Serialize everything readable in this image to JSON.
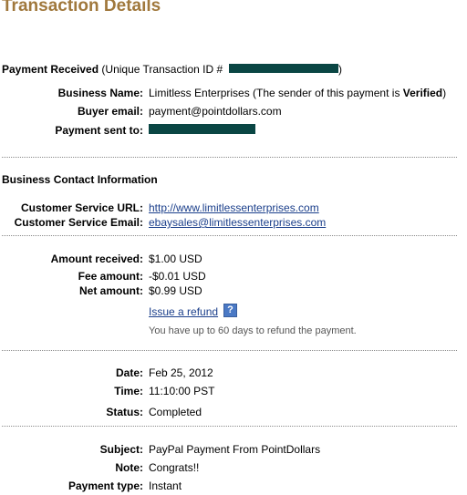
{
  "page": {
    "title": "Transaction Details"
  },
  "payment": {
    "received_label": "Payment Received",
    "transaction_prefix": "(Unique Transaction ID #",
    "transaction_suffix": ")",
    "business_name_label": "Business Name:",
    "business_name_value": "Limitless Enterprises (The sender of this payment is ",
    "verified_text": "Verified",
    "close_paren": ")",
    "buyer_email_label": "Buyer email:",
    "buyer_email_value": "payment@pointdollars.com",
    "sent_to_label": "Payment sent to:"
  },
  "contact": {
    "heading": "Business Contact Information",
    "url_label": "Customer Service URL:",
    "url_value": "http://www.limitlessenterprises.com",
    "email_label": "Customer Service Email:",
    "email_value": "ebaysales@limitlessenterprises.com"
  },
  "amounts": {
    "received_label": "Amount received:",
    "received_value": "$1.00 USD",
    "fee_label": "Fee amount:",
    "fee_value": "-$0.01 USD",
    "net_label": "Net amount:",
    "net_value": "$0.99 USD",
    "refund_link": "Issue a refund",
    "help_glyph": "?",
    "refund_note": "You have up to 60 days to refund the payment."
  },
  "timing": {
    "date_label": "Date:",
    "date_value": "Feb 25, 2012",
    "time_label": "Time:",
    "time_value": "11:10:00 PST",
    "status_label": "Status:",
    "status_value": "Completed"
  },
  "details": {
    "subject_label": "Subject:",
    "subject_value": "PayPal Payment From PointDollars",
    "note_label": "Note:",
    "note_value": "Congrats!!",
    "type_label": "Payment type:",
    "type_value": "Instant"
  },
  "colors": {
    "title": "#a0783c",
    "link": "#1b3f8b",
    "redaction": "#0a4644",
    "help_icon": "#4a79c5"
  },
  "icons": {
    "help": "help-icon"
  }
}
